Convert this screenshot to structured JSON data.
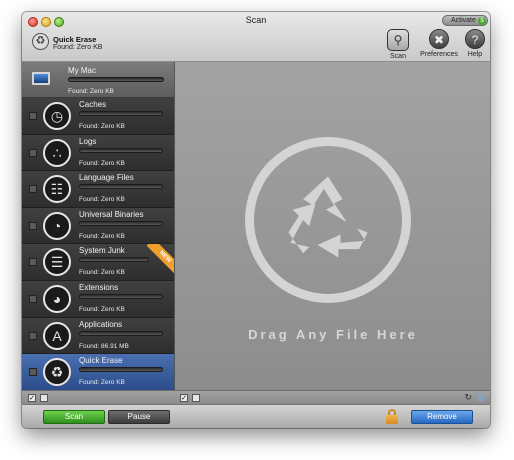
{
  "window": {
    "title": "Scan",
    "activate_label": "Activate",
    "activate_badge": "$"
  },
  "header": {
    "mode_title": "Quick Erase",
    "mode_found": "Found: Zero KB",
    "tools": [
      {
        "label": "Scan",
        "icon": "magnifier-icon"
      },
      {
        "label": "Preferences",
        "icon": "tools-icon"
      },
      {
        "label": "Help",
        "icon": "question-icon"
      }
    ]
  },
  "sidebar": {
    "mymac": {
      "name": "My Mac",
      "found": "Found: Zero KB"
    },
    "items": [
      {
        "label": "Caches",
        "found": "Found: Zero KB",
        "icon": "clock-icon"
      },
      {
        "label": "Logs",
        "found": "Found: Zero KB",
        "icon": "logs-icon"
      },
      {
        "label": "Language Files",
        "found": "Found: Zero KB",
        "icon": "globe-icon"
      },
      {
        "label": "Universal Binaries",
        "found": "Found: Zero KB",
        "icon": "binaries-icon"
      },
      {
        "label": "System Junk",
        "found": "Found: Zero KB",
        "icon": "system-junk-icon",
        "badge": "NEW"
      },
      {
        "label": "Extensions",
        "found": "Found: Zero KB",
        "icon": "gauge-icon"
      },
      {
        "label": "Applications",
        "found": "Found: 86.91 MB",
        "icon": "applications-icon"
      },
      {
        "label": "Quick Erase",
        "found": "Found: Zero KB",
        "icon": "recycle-icon"
      }
    ]
  },
  "main": {
    "drop_text": "Drag Any File Here",
    "icon": "recycle-icon"
  },
  "footer": {
    "scan_label": "Scan",
    "pause_label": "Pause",
    "remove_label": "Remove"
  },
  "colors": {
    "scan_button": "#3aa024",
    "remove_button": "#2f77d1",
    "badge": "#f0a02a",
    "selected_item": "#3a5c9c"
  }
}
